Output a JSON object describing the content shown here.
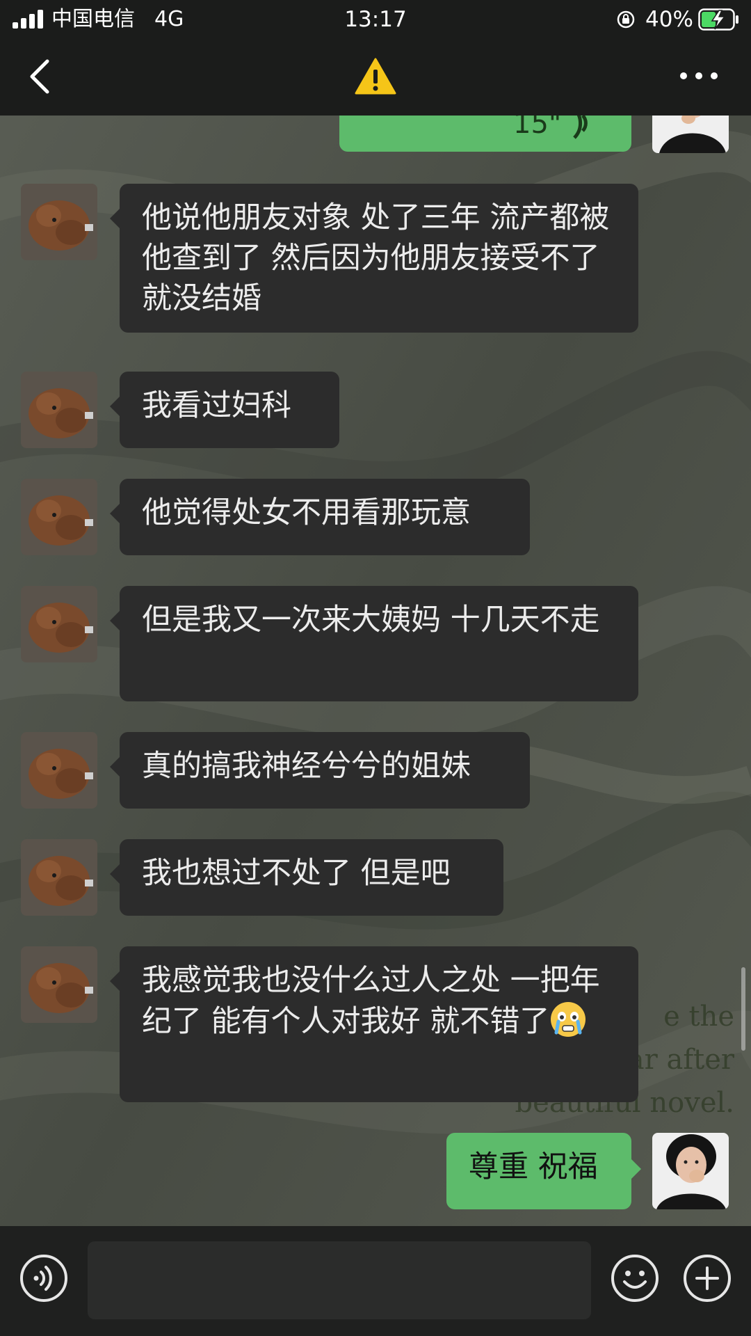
{
  "status_bar": {
    "carrier": "中国电信",
    "network": "4G",
    "time": "13:17",
    "battery_percent": "40%"
  },
  "nav": {
    "title_icon": "warning-icon"
  },
  "wallpaper_text": "e the\nar after\nbeautiful novel.",
  "messages": [
    {
      "from": "other",
      "text": "他说他朋友对象 处了三年 流产都被他查到了 然后因为他朋友接受不了 就没结婚"
    },
    {
      "from": "other",
      "text": "我看过妇科"
    },
    {
      "from": "other",
      "text": "他觉得处女不用看那玩意"
    },
    {
      "from": "other",
      "text": "但是我又一次来大姨妈 十几天不走"
    },
    {
      "from": "other",
      "text": "真的搞我神经兮兮的姐妹"
    },
    {
      "from": "other",
      "text": "我也想过不处了 但是吧"
    },
    {
      "from": "other",
      "text": "我感觉我也没什么过人之处 一把年纪了 能有个人对我好 就不错了",
      "emoji": "crying-face-emoji"
    },
    {
      "from": "me",
      "text": "尊重 祝福"
    }
  ],
  "partial_top_message": {
    "from": "me",
    "text": "15\""
  },
  "input": {
    "value": "",
    "placeholder": ""
  },
  "colors": {
    "bar_bg": "#1b1c1b",
    "incoming_bubble": "#2c2c2c",
    "outgoing_bubble": "#5dbb6b",
    "wallpaper": "#4b4f47"
  }
}
